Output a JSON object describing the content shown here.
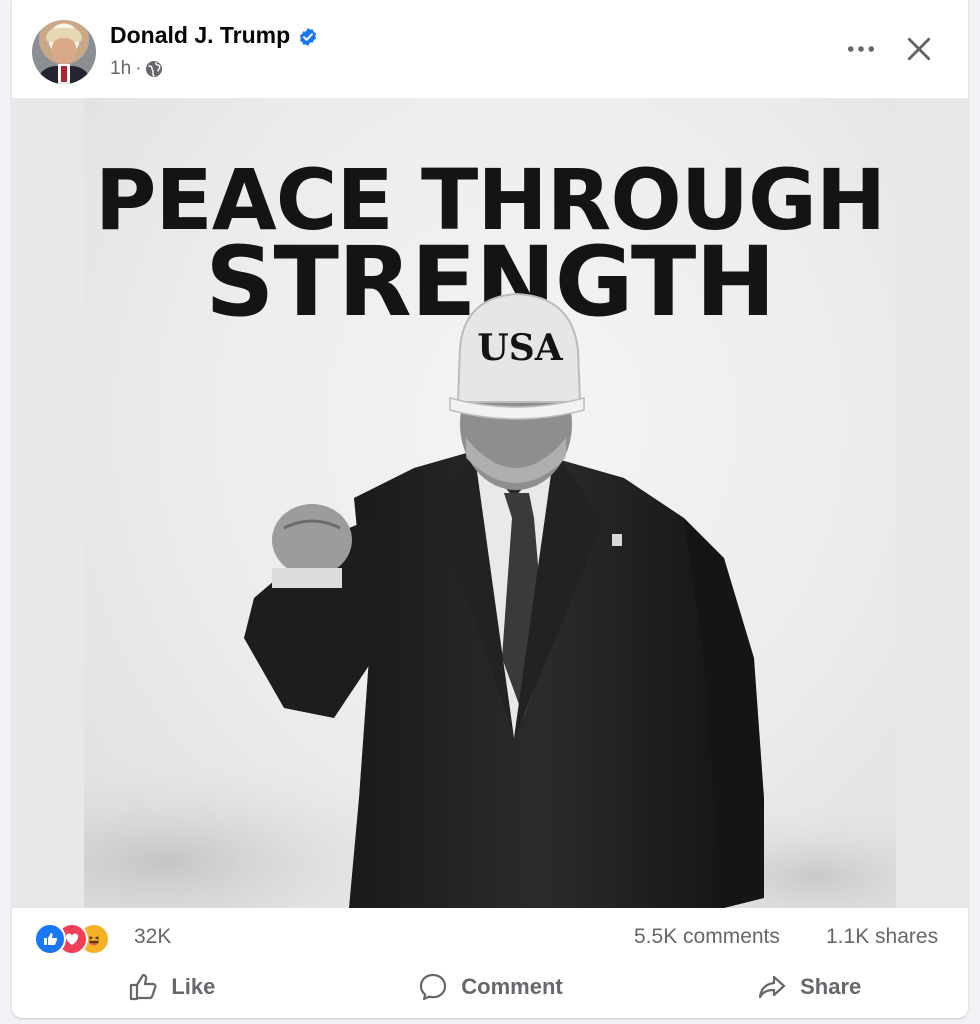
{
  "post": {
    "author": "Donald J. Trump",
    "time": "1h",
    "separator": "·",
    "verified": true,
    "privacy_icon": "globe-icon"
  },
  "image": {
    "headline_line1": "PEACE THROUGH",
    "headline_line2": "STRENGTH",
    "cap_text": "USA"
  },
  "stats": {
    "reaction_icons": [
      "like-icon",
      "love-icon",
      "haha-icon"
    ],
    "reaction_count": "32K",
    "comments": "5.5K comments",
    "shares": "1.1K shares"
  },
  "actions": {
    "like": "Like",
    "comment": "Comment",
    "share": "Share"
  },
  "colors": {
    "accent": "#1877f2",
    "love": "#f33e58",
    "haha": "#f7b125",
    "text_secondary": "#65676b"
  }
}
